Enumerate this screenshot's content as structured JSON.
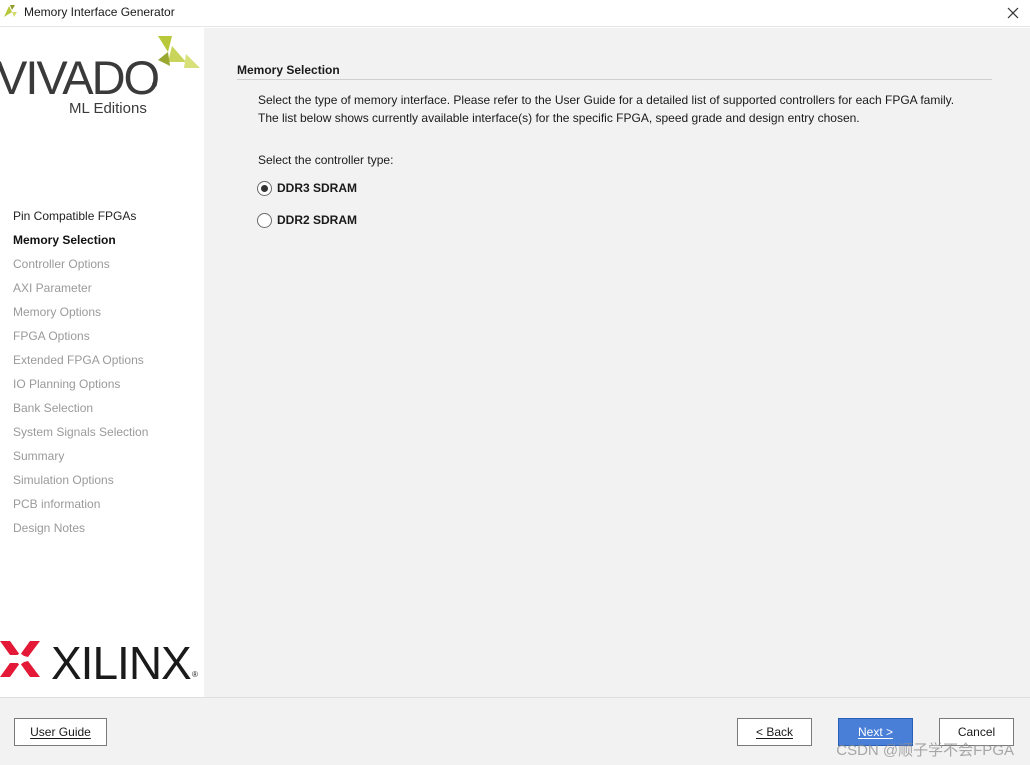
{
  "window": {
    "title": "Memory Interface Generator",
    "icon": "vivado-app-icon",
    "close_icon": "close-icon"
  },
  "branding": {
    "vivado_word": "VIVADO",
    "vivado_reg": "®",
    "vivado_edition": "ML Editions",
    "xilinx_word": "XILINX",
    "xilinx_reg": "®"
  },
  "colors": {
    "accent_green": "#b9c83a",
    "xilinx_red": "#e31937",
    "primary_button": "#4a7fd8"
  },
  "sidebar": {
    "steps": [
      {
        "label": "Pin Compatible FPGAs",
        "state": "done"
      },
      {
        "label": "Memory Selection",
        "state": "current"
      },
      {
        "label": "Controller Options",
        "state": "pending"
      },
      {
        "label": "AXI Parameter",
        "state": "pending"
      },
      {
        "label": "Memory Options",
        "state": "pending"
      },
      {
        "label": "FPGA Options",
        "state": "pending"
      },
      {
        "label": "Extended FPGA Options",
        "state": "pending"
      },
      {
        "label": "IO Planning Options",
        "state": "pending"
      },
      {
        "label": "Bank Selection",
        "state": "pending"
      },
      {
        "label": "System Signals Selection",
        "state": "pending"
      },
      {
        "label": "Summary",
        "state": "pending"
      },
      {
        "label": "Simulation Options",
        "state": "pending"
      },
      {
        "label": "PCB information",
        "state": "pending"
      },
      {
        "label": "Design Notes",
        "state": "pending"
      }
    ]
  },
  "main": {
    "section_title": "Memory Selection",
    "description_line1": "Select the type of memory interface. Please refer to the User Guide for a detailed list of supported controllers for each FPGA family.",
    "description_line2": "The list below shows currently available interface(s) for the specific FPGA, speed grade and design entry chosen.",
    "select_label": "Select the controller type:",
    "options": [
      {
        "label": "DDR3 SDRAM",
        "selected": true
      },
      {
        "label": "DDR2 SDRAM",
        "selected": false
      }
    ]
  },
  "footer": {
    "user_guide": "User Guide",
    "back": "< Back",
    "next": "Next >",
    "cancel": "Cancel"
  },
  "watermark": "CSDN @顺子学不会FPGA"
}
